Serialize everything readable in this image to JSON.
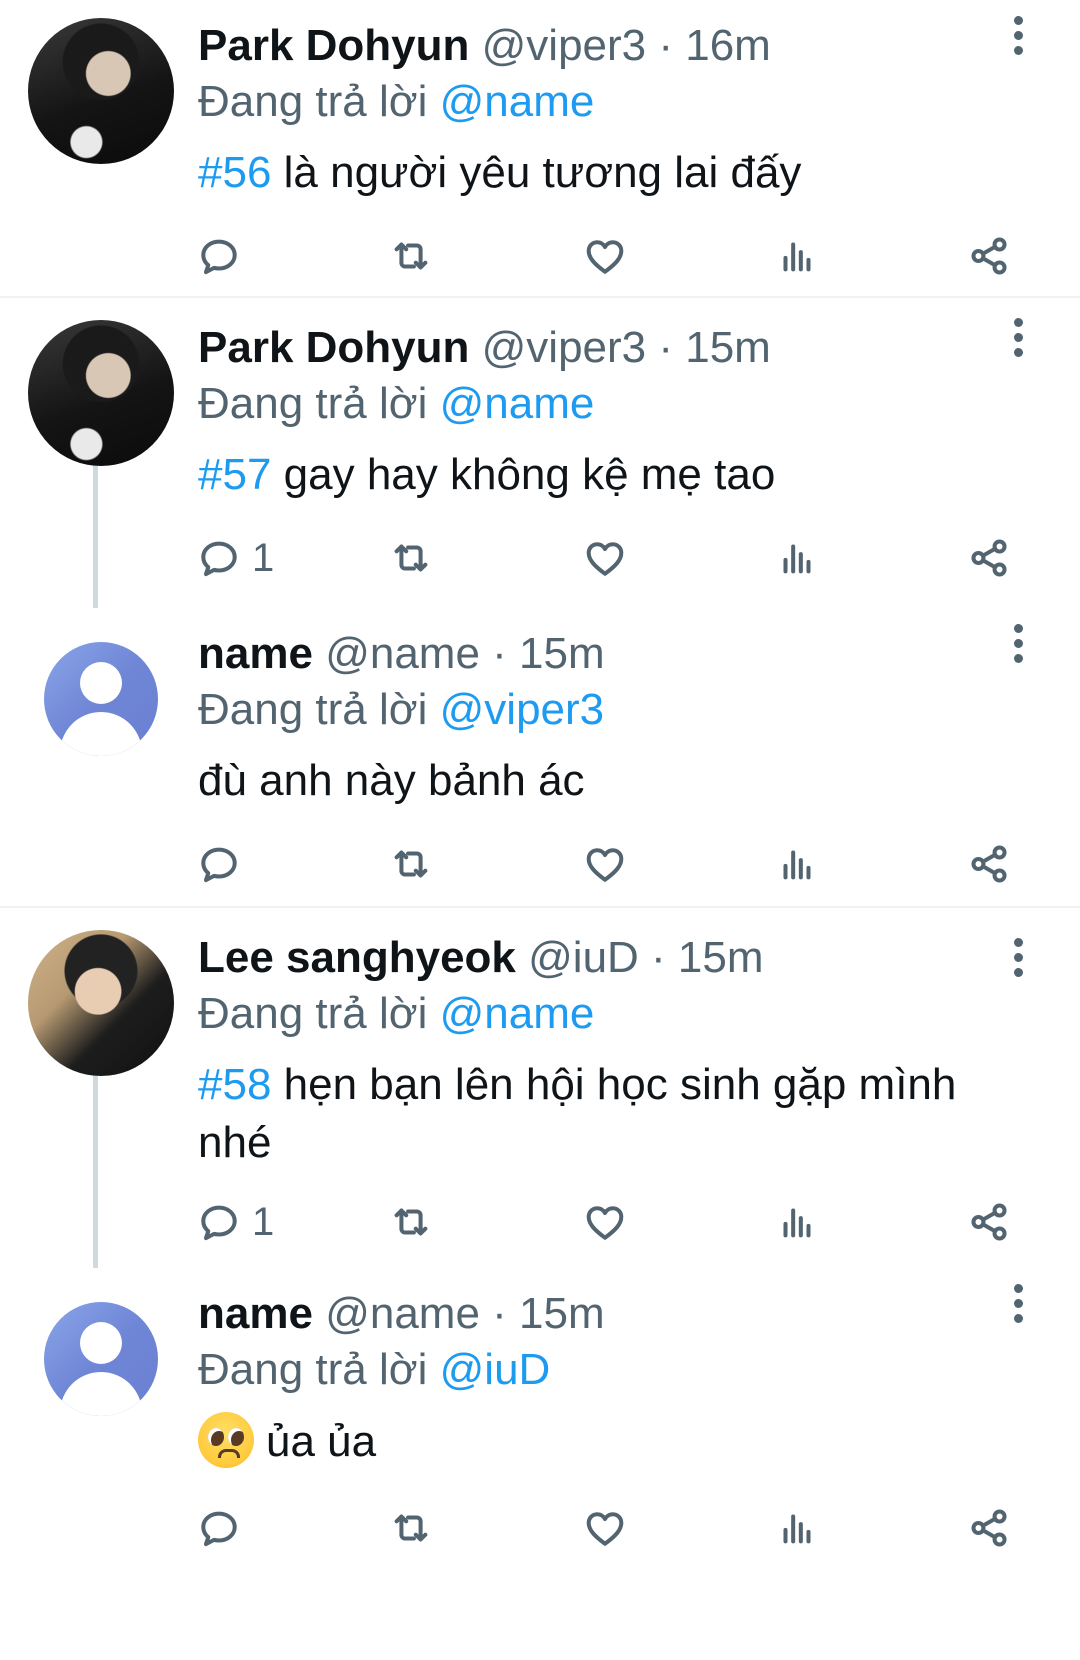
{
  "reply_prefix": "Đang trả lời",
  "tweets": [
    {
      "display_name": "Park Dohyun",
      "meta": "@viper3 · 16m",
      "reply_to": "@name",
      "hashtag": "#56",
      "text": " là người yêu tương lai đấy",
      "reply_count": ""
    },
    {
      "display_name": "Park Dohyun",
      "meta": "@viper3 · 15m",
      "reply_to": "@name",
      "hashtag": "#57",
      "text": " gay hay không kệ mẹ tao",
      "reply_count": "1"
    },
    {
      "display_name": "name",
      "meta": "@name · 15m",
      "reply_to": "@viper3",
      "hashtag": "",
      "text": "đù anh này bảnh ác",
      "reply_count": ""
    },
    {
      "display_name": "Lee sanghyeok",
      "meta": "@iuD · 15m",
      "reply_to": "@name",
      "hashtag": "#58",
      "text": " hẹn bạn lên hội học sinh gặp mình nhé",
      "reply_count": "1"
    },
    {
      "display_name": "name",
      "meta": "@name · 15m",
      "reply_to": "@iuD",
      "hashtag": "",
      "emoji": "pleading-face-emoji",
      "text": "ủa ủa",
      "reply_count": ""
    }
  ],
  "icons": {
    "reply": "reply-icon",
    "retweet": "retweet-icon",
    "like": "heart-icon",
    "views": "views-icon",
    "share": "share-icon",
    "more": "more-options-icon"
  },
  "colors": {
    "link": "#1d9bf0",
    "secondary": "#536471",
    "primary_text": "#0f1419",
    "thread_line": "#cfd9de"
  }
}
